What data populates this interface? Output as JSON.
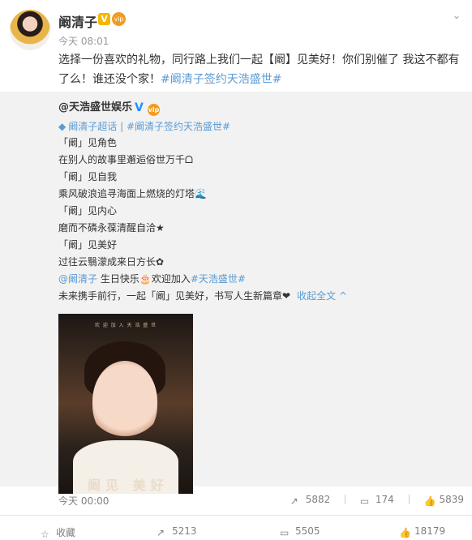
{
  "post": {
    "username": "阚清子",
    "badge_v": "V",
    "badge_vip": "vip",
    "time": "今天 08:01",
    "text_main": "选择一份喜欢的礼物，同行路上我们一起【阚】见美好！你们别催了 我这不都有了么！谁还没个家！",
    "hashtag": "#阚清子签约天浩盛世#"
  },
  "repost": {
    "user": "@天浩盛世娱乐",
    "v": "V",
    "tag1": "阚清子超话",
    "sep": "|",
    "tag2": "#阚清子签约天浩盛世#",
    "lines": [
      "「阚」见角色",
      "在别人的故事里邂逅俗世万千ᗝ",
      "「阚」见自我",
      "乘风破浪追寻海面上燃烧的灯塔",
      "「阚」见内心",
      "磨而不磷永葆清醒自洽",
      "「阚」见美好",
      "过往云翳濛成来日方长"
    ],
    "mention": "@阚清子",
    "birthday": "生日快乐",
    "welcome": "欢迎加入",
    "welcome_tag": "#天浩盛世#",
    "last_line": "未来携手前行，一起「阚」见美好，书写人生新篇章",
    "collapse": "收起全文 ^",
    "poster_topline": "欢 迎 加 入 天 浩 盛 世",
    "poster_bottom": "阚见 美好",
    "time": "今天 00:00",
    "stats": {
      "forward": "5882",
      "comment": "174",
      "like": "5839"
    }
  },
  "bottombar": {
    "collect": "收藏",
    "forward": "5213",
    "comment": "5505",
    "like": "18179"
  }
}
